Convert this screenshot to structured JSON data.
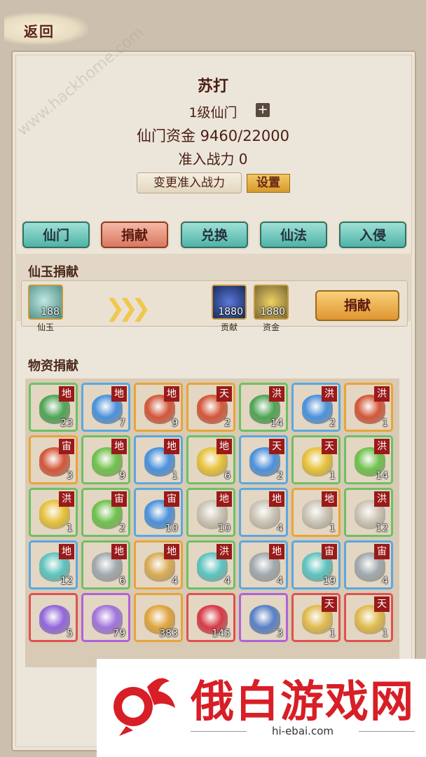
{
  "back": {
    "label": "返回"
  },
  "sect": {
    "name": "苏打",
    "level": "1级仙门",
    "plus": "+",
    "funds": "仙门资金 9460/22000",
    "entry_power": "准入战力 0",
    "change_button": "变更准入战力",
    "set_button": "设置"
  },
  "tabs": [
    "仙门",
    "捐献",
    "兑换",
    "仙法",
    "入侵"
  ],
  "active_tab": "捐献",
  "jade_donation": {
    "title": "仙玉捐献",
    "cost": {
      "count": "188",
      "label": "仙玉"
    },
    "rewards": [
      {
        "count": "1880",
        "label": "贡献"
      },
      {
        "count": "1880",
        "label": "资金"
      }
    ],
    "button": "捐献"
  },
  "material_donation": {
    "title": "物资捐献",
    "items": [
      {
        "icon": "green-leaf",
        "tag": "地",
        "count": "23",
        "rarity": "green",
        "color": "#3fa04a"
      },
      {
        "icon": "blue-flower",
        "tag": "地",
        "count": "7",
        "rarity": "blue",
        "color": "#3a8ae0"
      },
      {
        "icon": "red-leaf",
        "tag": "地",
        "count": "9",
        "rarity": "orange",
        "color": "#d2482a"
      },
      {
        "icon": "red-leaf",
        "tag": "天",
        "count": "2",
        "rarity": "orange",
        "color": "#d2482a"
      },
      {
        "icon": "green-leaf",
        "tag": "洪",
        "count": "14",
        "rarity": "green",
        "color": "#3fa04a"
      },
      {
        "icon": "blue-flower",
        "tag": "洪",
        "count": "2",
        "rarity": "blue",
        "color": "#3a8ae0"
      },
      {
        "icon": "red-leaf",
        "tag": "洪",
        "count": "1",
        "rarity": "orange",
        "color": "#d2482a"
      },
      {
        "icon": "red-leaf",
        "tag": "宙",
        "count": "3",
        "rarity": "orange",
        "color": "#d2482a"
      },
      {
        "icon": "green-crystal",
        "tag": "地",
        "count": "9",
        "rarity": "green",
        "color": "#62c040"
      },
      {
        "icon": "blue-crystal",
        "tag": "地",
        "count": "1",
        "rarity": "blue",
        "color": "#3a8ae0"
      },
      {
        "icon": "yellow-crystal",
        "tag": "地",
        "count": "6",
        "rarity": "green",
        "color": "#e8c02a"
      },
      {
        "icon": "blue-crystal",
        "tag": "天",
        "count": "2",
        "rarity": "blue",
        "color": "#3a8ae0"
      },
      {
        "icon": "yellow-crystal",
        "tag": "天",
        "count": "1",
        "rarity": "green",
        "color": "#e8c02a"
      },
      {
        "icon": "green-crystal",
        "tag": "洪",
        "count": "14",
        "rarity": "green",
        "color": "#62c040"
      },
      {
        "icon": "yellow-crystal",
        "tag": "洪",
        "count": "1",
        "rarity": "green",
        "color": "#e8c02a"
      },
      {
        "icon": "green-crystal",
        "tag": "宙",
        "count": "2",
        "rarity": "green",
        "color": "#62c040"
      },
      {
        "icon": "blue-crystal",
        "tag": "宙",
        "count": "10",
        "rarity": "blue",
        "color": "#3a8ae0"
      },
      {
        "icon": "scroll",
        "tag": "地",
        "count": "10",
        "rarity": "green",
        "color": "#c8c2b4"
      },
      {
        "icon": "scroll",
        "tag": "地",
        "count": "4",
        "rarity": "blue",
        "color": "#c8c2b4"
      },
      {
        "icon": "scroll",
        "tag": "地",
        "count": "1",
        "rarity": "orange",
        "color": "#c8c2b4"
      },
      {
        "icon": "scroll",
        "tag": "洪",
        "count": "12",
        "rarity": "green",
        "color": "#c8c2b4"
      },
      {
        "icon": "teal-ingot",
        "tag": "地",
        "count": "12",
        "rarity": "blue",
        "color": "#4ec2c0"
      },
      {
        "icon": "silver-ingot",
        "tag": "地",
        "count": "6",
        "rarity": "green",
        "color": "#9aa4ac"
      },
      {
        "icon": "gold-ingot",
        "tag": "地",
        "count": "4",
        "rarity": "orange",
        "color": "#d8a84a"
      },
      {
        "icon": "teal-ingot",
        "tag": "洪",
        "count": "4",
        "rarity": "green",
        "color": "#4ec2c0"
      },
      {
        "icon": "silver-ingot",
        "tag": "地",
        "count": "4",
        "rarity": "blue",
        "color": "#9aa4ac"
      },
      {
        "icon": "teal-ingot",
        "tag": "宙",
        "count": "19",
        "rarity": "blue",
        "color": "#4ec2c0"
      },
      {
        "icon": "silver-ingot",
        "tag": "宙",
        "count": "4",
        "rarity": "blue",
        "color": "#9aa4ac"
      },
      {
        "icon": "purple-feather",
        "tag": "",
        "count": "5",
        "rarity": "red",
        "color": "#8a5ae0"
      },
      {
        "icon": "purple-gem",
        "tag": "",
        "count": "79",
        "rarity": "purple",
        "color": "#9a6ae0"
      },
      {
        "icon": "gold-pouch",
        "tag": "",
        "count": "383",
        "rarity": "orange",
        "color": "#e0a030"
      },
      {
        "icon": "red-key",
        "tag": "",
        "count": "145",
        "rarity": "red",
        "color": "#d8283a"
      },
      {
        "icon": "blue-box",
        "tag": "",
        "count": "3",
        "rarity": "purple",
        "color": "#4a78c8"
      },
      {
        "icon": "gold-scroll",
        "tag": "天",
        "count": "1",
        "rarity": "red",
        "color": "#e0b840"
      },
      {
        "icon": "gold-scroll",
        "tag": "天",
        "count": "1",
        "rarity": "red",
        "color": "#e0b840"
      }
    ]
  },
  "watermarks": {
    "site_title": "俄白游戏网",
    "site_url": "hi-ebai.com",
    "diagonal": "www.hackhome.com"
  }
}
